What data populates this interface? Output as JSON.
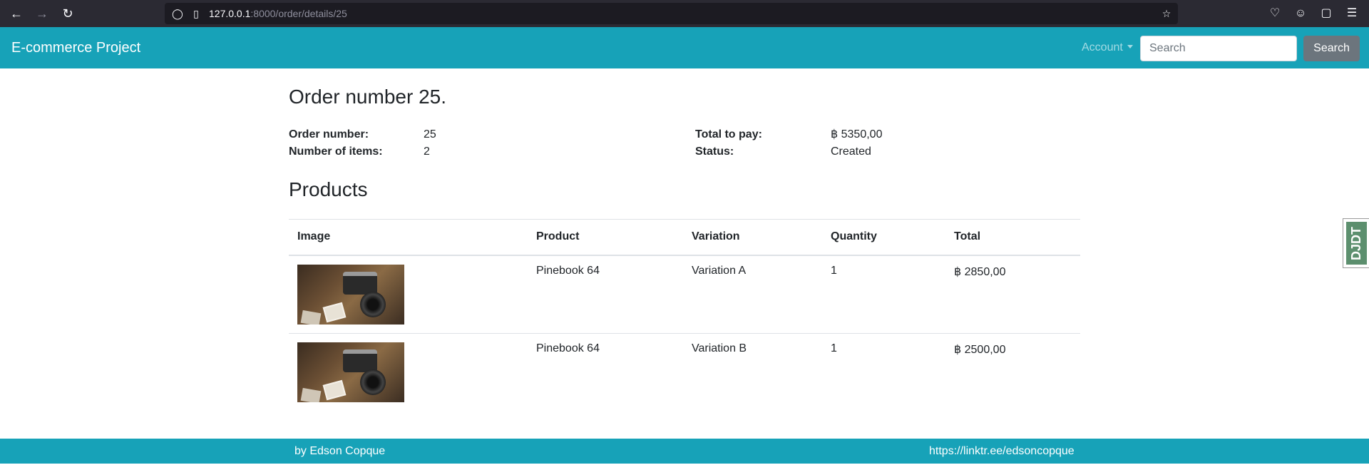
{
  "browser": {
    "url_host": "127.0.0.1",
    "url_rest": ":8000/order/details/25"
  },
  "navbar": {
    "brand": "E-commerce Project",
    "account_label": "Account",
    "search_placeholder": "Search",
    "search_button": "Search"
  },
  "order": {
    "title": "Order number 25.",
    "fields": {
      "order_number_label": "Order number:",
      "order_number_value": "25",
      "items_label": "Number of items:",
      "items_value": "2",
      "total_label": "Total to pay:",
      "total_value": "฿ 5350,00",
      "status_label": "Status:",
      "status_value": "Created"
    }
  },
  "products": {
    "title": "Products",
    "columns": [
      "Image",
      "Product",
      "Variation",
      "Quantity",
      "Total"
    ],
    "rows": [
      {
        "product": "Pinebook 64",
        "variation": "Variation A",
        "quantity": "1",
        "total": "฿ 2850,00"
      },
      {
        "product": "Pinebook 64",
        "variation": "Variation B",
        "quantity": "1",
        "total": "฿ 2500,00"
      }
    ]
  },
  "djdt": {
    "label": "DJDT"
  },
  "footer": {
    "left": "by Edson Copque",
    "right": "https://linktr.ee/edsoncopque"
  },
  "colors": {
    "navbar_bg": "#17a2b8",
    "button_secondary": "#6c757d",
    "browser_chrome": "#2b2a33"
  }
}
